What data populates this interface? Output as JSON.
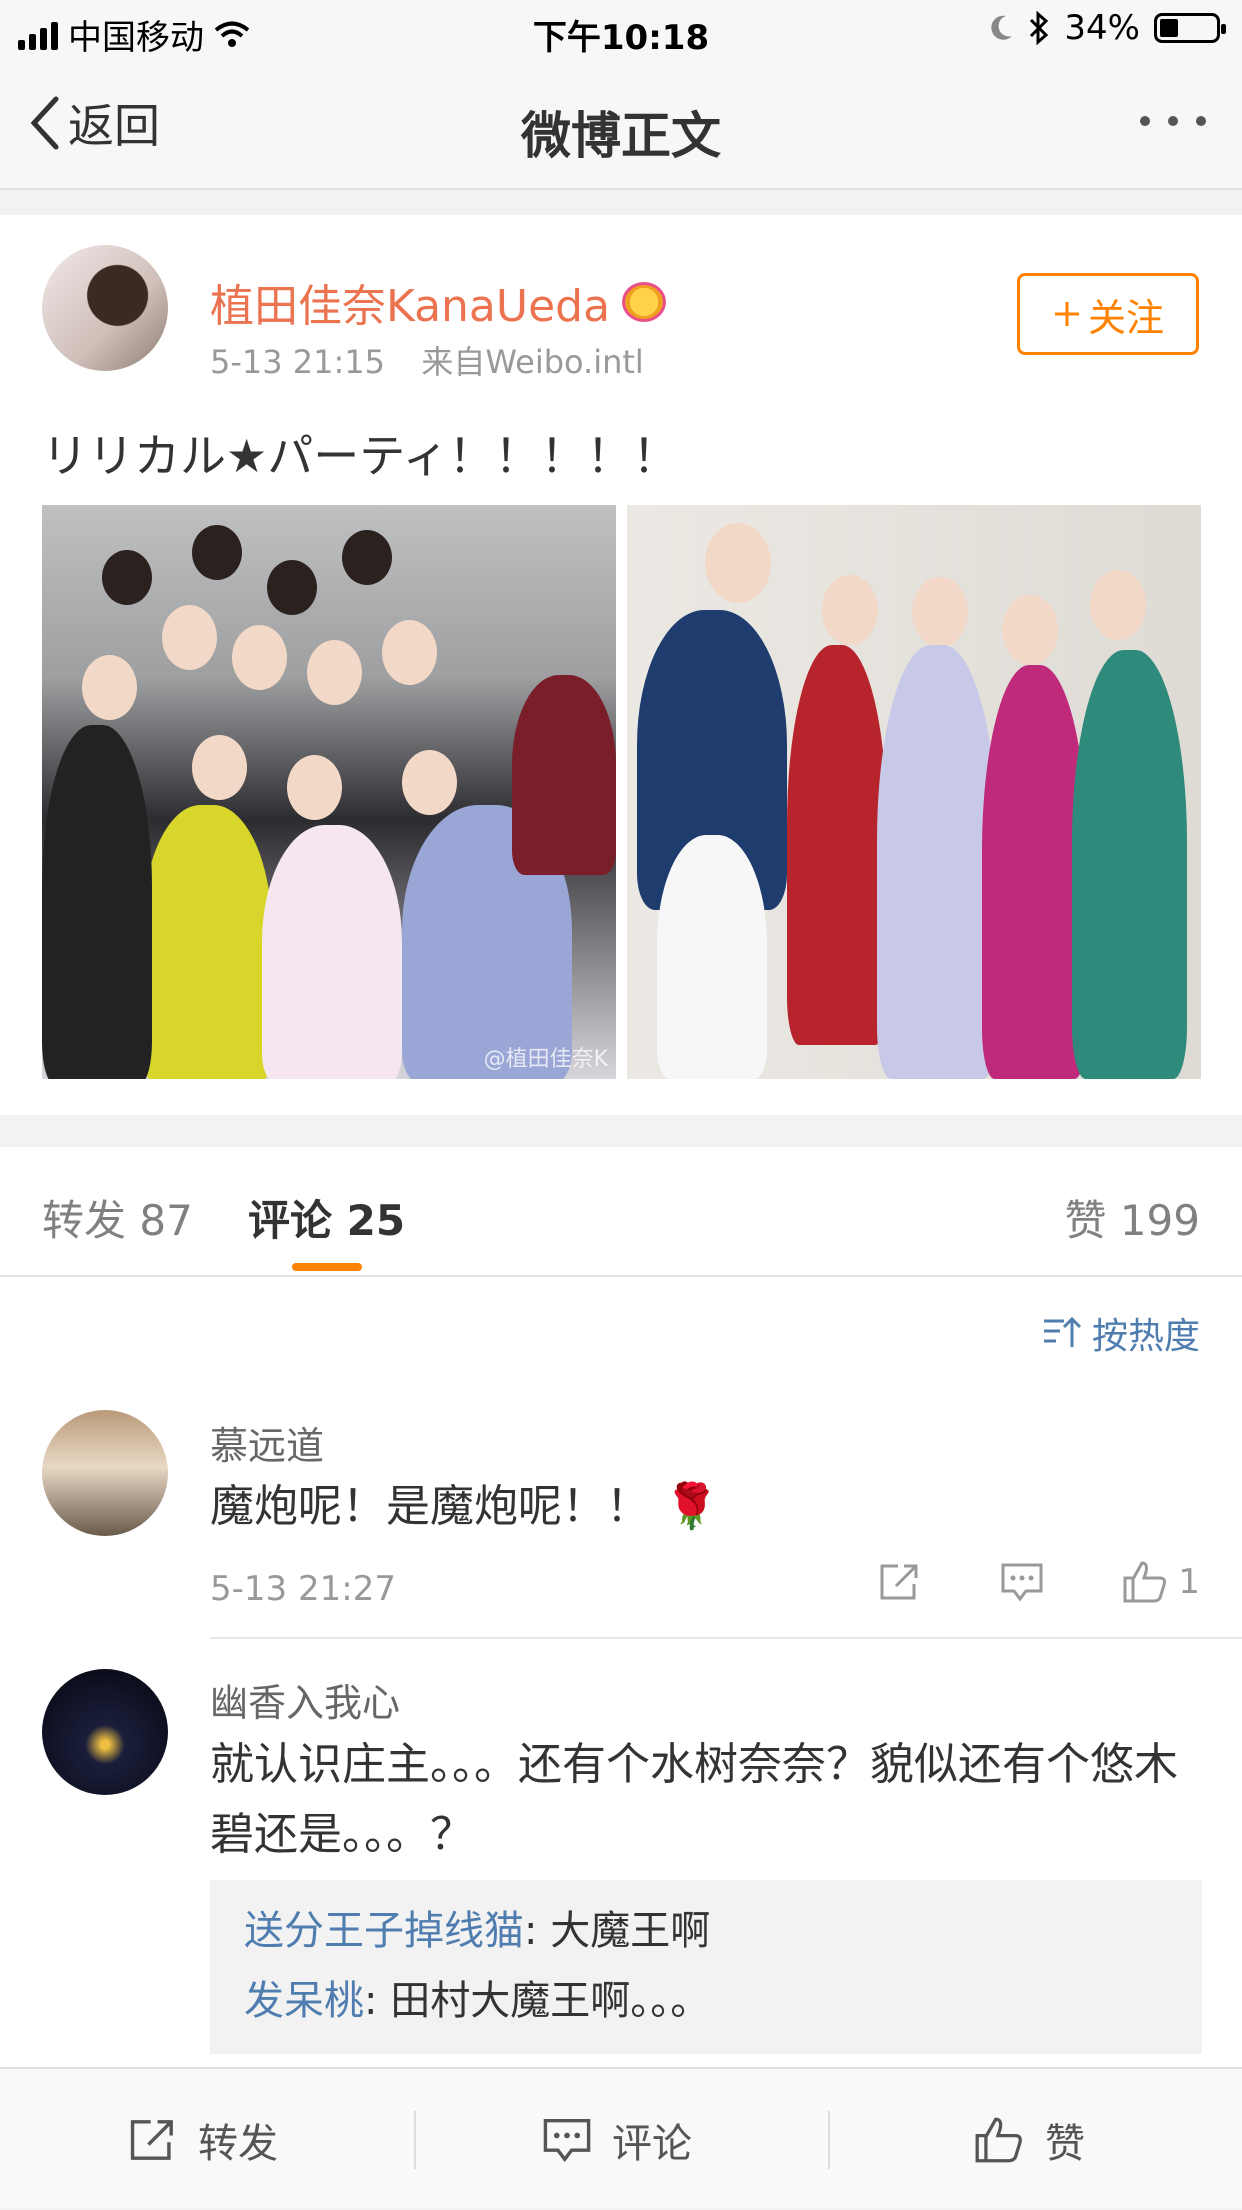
{
  "status_bar": {
    "carrier": "中国移动",
    "time": "下午10:18",
    "battery": "34%"
  },
  "navbar": {
    "back_label": "返回",
    "title": "微博正文"
  },
  "post": {
    "author": "植田佳奈KanaUeda",
    "time": "5-13 21:15",
    "source": "来自Weibo.intl",
    "follow_label": "关注",
    "text": "リリカル★パーティ！！！！！",
    "watermark": "@植田佳奈K"
  },
  "tabs": {
    "repost": "转发 87",
    "comment": "评论 25",
    "like": "赞 199"
  },
  "sort_label": "按热度",
  "comments": [
    {
      "user": "慕远道",
      "text": "魔炮呢！是魔炮呢！！ 🌹",
      "time": "5-13 21:27",
      "likes": "1"
    },
    {
      "user": "幽香入我心",
      "text": "就认识庄主。。。还有个水树奈奈？貌似还有个悠木碧还是。。。？",
      "replies": [
        {
          "user": "送分王子掉线猫",
          "text": ": 大魔王啊"
        },
        {
          "user": "发呆桃",
          "text": ": 田村大魔王啊。。。"
        }
      ]
    }
  ],
  "bottom_bar": {
    "repost": "转发",
    "comment": "评论",
    "like": "赞"
  },
  "colors": {
    "accent_orange": "#ff8200",
    "author_orange": "#eb7350",
    "link_blue": "#507daf"
  }
}
